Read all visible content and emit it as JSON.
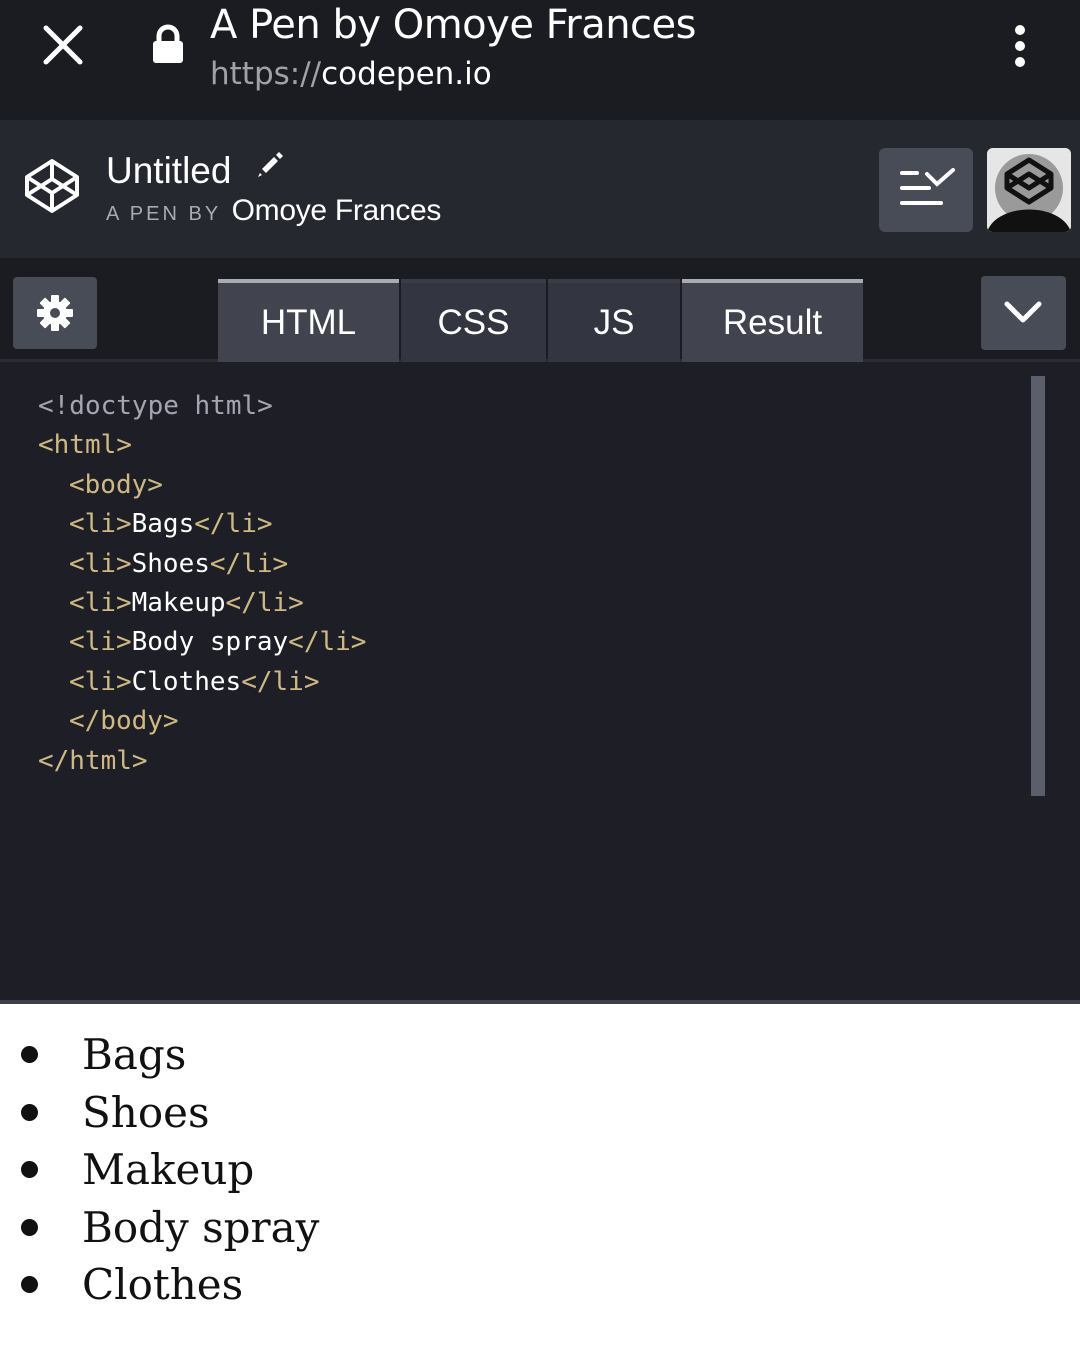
{
  "browser": {
    "title": "A Pen by Omoye Frances",
    "url_scheme": "https://",
    "url_host": "codepen.io"
  },
  "pen": {
    "title": "Untitled",
    "by_label": "A PEN BY",
    "author": "Omoye Frances"
  },
  "tabs": [
    {
      "label": "HTML",
      "active": true
    },
    {
      "label": "CSS",
      "active": false
    },
    {
      "label": "JS",
      "active": false
    },
    {
      "label": "Result",
      "active": true
    }
  ],
  "code": {
    "doctype": "<!doctype html>",
    "html_open": "<html>",
    "body_open": "<body>",
    "items": [
      "Bags",
      "Shoes",
      "Makeup",
      "Body spray",
      "Clothes"
    ],
    "li_open": "<li>",
    "li_close": "</li>",
    "body_close": "</body>",
    "html_close": "</html>"
  },
  "result": {
    "items": [
      "Bags",
      "Shoes",
      "Makeup",
      "Body spray",
      "Clothes"
    ]
  },
  "icons": {
    "close": "close-icon",
    "lock": "lock-icon",
    "menu": "kebab-menu-icon",
    "logo": "codepen-logo-icon",
    "edit": "pencil-icon",
    "layout": "layout-icon",
    "settings": "gear-icon",
    "collapse": "chevron-down-icon"
  },
  "colors": {
    "browser_bar": "#1b1c21",
    "header": "#26282f",
    "editor_bg": "#1e1f26",
    "tag": "#cfb982",
    "button": "#484c57"
  }
}
